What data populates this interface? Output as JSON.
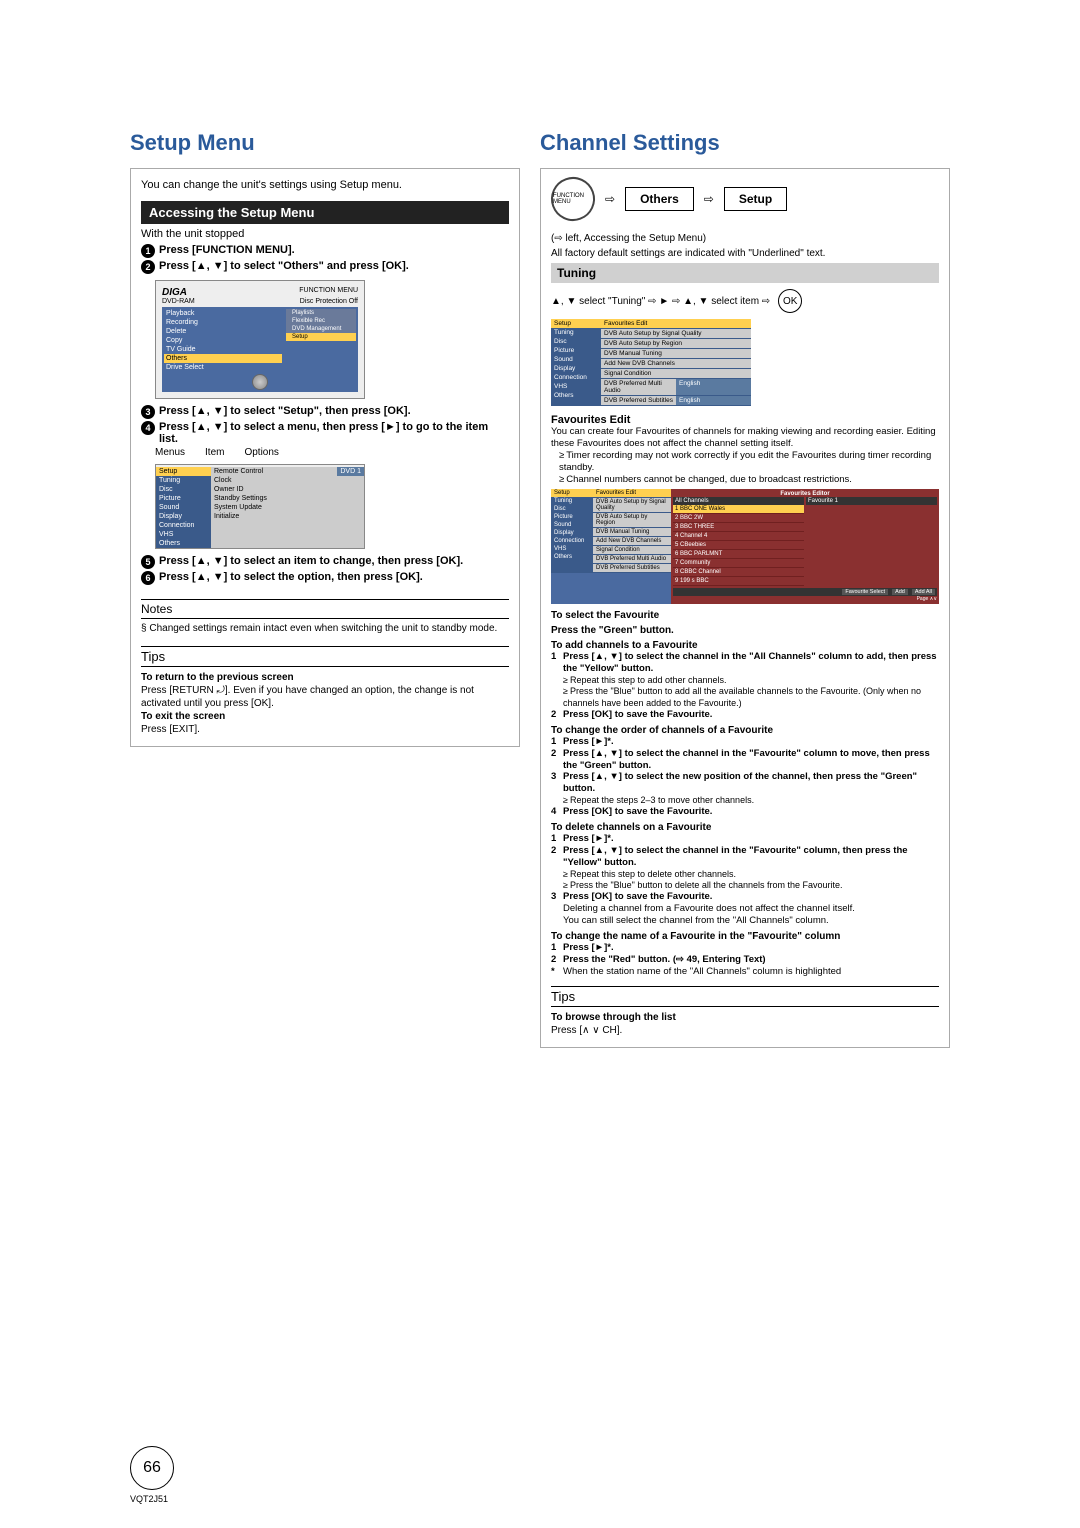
{
  "left": {
    "title": "Setup Menu",
    "intro": "You can change the unit's settings using Setup menu.",
    "accessing_header": "Accessing the Setup Menu",
    "with_stopped": "With the unit stopped",
    "step1": "Press [FUNCTION MENU].",
    "step2": "Press [▲, ▼] to select \"Others\" and press [OK].",
    "step3": "Press [▲, ▼] to select \"Setup\", then press [OK].",
    "step4": "Press [▲, ▼] to select a menu, then press [►] to go to the item list.",
    "menus_label": "Menus",
    "item_label": "Item",
    "options_label": "Options",
    "step5": "Press [▲, ▼] to select an item to change, then press [OK].",
    "step6": "Press [▲, ▼] to select the option, then press [OK].",
    "notes_header": "Notes",
    "notes_body": "Changed settings remain intact even when switching the unit to standby mode.",
    "tips_header": "Tips",
    "tips_return_h": "To return to the previous screen",
    "tips_return_b": "Press [RETURN ⤾]. Even if you have changed an option, the change is not activated until you press [OK].",
    "tips_exit_h": "To exit the screen",
    "tips_exit_b": "Press [EXIT].",
    "mock1": {
      "brand": "DIGA",
      "fm": "FUNCTION MENU",
      "dvd": "DVD-RAM",
      "prot": "Disc Protection Off",
      "items": [
        "Playback",
        "Recording",
        "Delete",
        "Copy",
        "TV Guide",
        "Others",
        "Drive Select"
      ],
      "right_items": [
        "Playlists",
        "Flexible Rec",
        "DVD Management",
        "Setup"
      ]
    },
    "mock2": {
      "side": [
        "Setup",
        "Tuning",
        "Disc",
        "Picture",
        "Sound",
        "Display",
        "Connection",
        "VHS",
        "Others"
      ],
      "items": [
        "Remote Control",
        "Clock",
        "Owner ID",
        "Standby Settings",
        "System Update",
        "Initialize"
      ],
      "opt": "DVD 1"
    }
  },
  "right": {
    "title": "Channel Settings",
    "fn_label": "FUNCTION MENU",
    "others": "Others",
    "setup": "Setup",
    "ref": "(⇨ left, Accessing the Setup Menu)",
    "factory": "All factory default settings are indicated with \"Underlined\" text.",
    "tuning_header": "Tuning",
    "nav": "▲, ▼ select \"Tuning\" ⇨ ► ⇨ ▲, ▼ select item ⇨",
    "ok": "OK",
    "setup_mock": {
      "side": [
        "Setup",
        "Tuning",
        "Disc",
        "Picture",
        "Sound",
        "Display",
        "Connection",
        "VHS",
        "Others"
      ],
      "items": [
        "Favourites Edit",
        "DVB Auto Setup by Signal Quality",
        "DVB Auto Setup by Region",
        "DVB Manual Tuning",
        "Add New DVB Channels",
        "Signal Condition",
        "DVB Preferred Multi Audio",
        "DVB Preferred Subtitles"
      ],
      "vals": [
        "",
        "",
        "",
        "",
        "",
        "",
        "English",
        "English"
      ]
    },
    "fav_edit_h": "Favourites Edit",
    "fav_edit_b1": "You can create four Favourites of channels for making viewing and recording easier. Editing these Favourites does not affect the channel setting itself.",
    "fav_edit_li1": "Timer recording may not work correctly if you edit the Favourites during timer recording standby.",
    "fav_edit_li2": "Channel numbers cannot be changed, due to broadcast restrictions.",
    "editor": {
      "side": [
        "Setup",
        "Tuning",
        "Disc",
        "Picture",
        "Sound",
        "Display",
        "Connection",
        "VHS",
        "Others"
      ],
      "items": [
        "Favourites Edit",
        "DVB Auto Setup by Signal Quality",
        "DVB Auto Setup by Region",
        "DVB Manual Tuning",
        "Add New DVB Channels",
        "Signal Condition",
        "DVB Preferred Multi Audio",
        "DVB Preferred Subtitles"
      ],
      "title": "Favourites Editor",
      "all_ch": "All Channels",
      "fav1": "Favourite 1",
      "channels": [
        "1 BBC ONE Wales",
        "2 BBC 2W",
        "3 BBC THREE",
        "4 Channel 4",
        "5 CBeebies",
        "6 BBC PARLMNT",
        "7 Community",
        "8 CBBC Channel",
        "9 199 s BBC"
      ],
      "btns": [
        "Favourite Select",
        "Add",
        "Add All"
      ],
      "page": "Page"
    },
    "sel_fav_h": "To select the Favourite",
    "sel_fav_b": "Press the \"Green\" button.",
    "add_h": "To add channels to a Favourite",
    "add_1": "Press [▲, ▼] to select the channel in the \"All Channels\" column to add, then press the \"Yellow\" button.",
    "add_1a": "Repeat this step to add other channels.",
    "add_1b": "Press the \"Blue\" button to add all the available channels to the Favourite. (Only when no channels have been added to the Favourite.)",
    "add_2": "Press [OK] to save the Favourite.",
    "chg_h": "To change the order of channels of a Favourite",
    "chg_1": "Press [►]*.",
    "chg_2": "Press [▲, ▼] to select the channel in the \"Favourite\" column to move, then press the \"Green\" button.",
    "chg_3": "Press [▲, ▼] to select the new position of the channel, then press the \"Green\" button.",
    "chg_3a": "Repeat the steps 2–3 to move other channels.",
    "chg_4": "Press [OK] to save the Favourite.",
    "del_h": "To delete channels on a Favourite",
    "del_1": "Press [►]*.",
    "del_2": "Press [▲, ▼] to select the channel in the \"Favourite\" column, then press the \"Yellow\" button.",
    "del_2a": "Repeat this step to delete other channels.",
    "del_2b": "Press the \"Blue\" button to delete all the channels from the Favourite.",
    "del_3": "Press [OK] to save the Favourite.",
    "del_3b": "Deleting a channel from a Favourite does not affect the channel itself.",
    "del_3c": "You can still select the channel from the \"All Channels\" column.",
    "name_h": "To change the name of a Favourite in the \"Favourite\" column",
    "name_1": "Press [►]*.",
    "name_2": "Press the \"Red\" button. (⇨ 49, Entering Text)",
    "star": "When the station name of the \"All Channels\" column is highlighted",
    "tips_h": "Tips",
    "tips_b_h": "To browse through the list",
    "tips_b": "Press [∧ ∨ CH]."
  },
  "page_number": "66",
  "footer": "VQT2J51"
}
